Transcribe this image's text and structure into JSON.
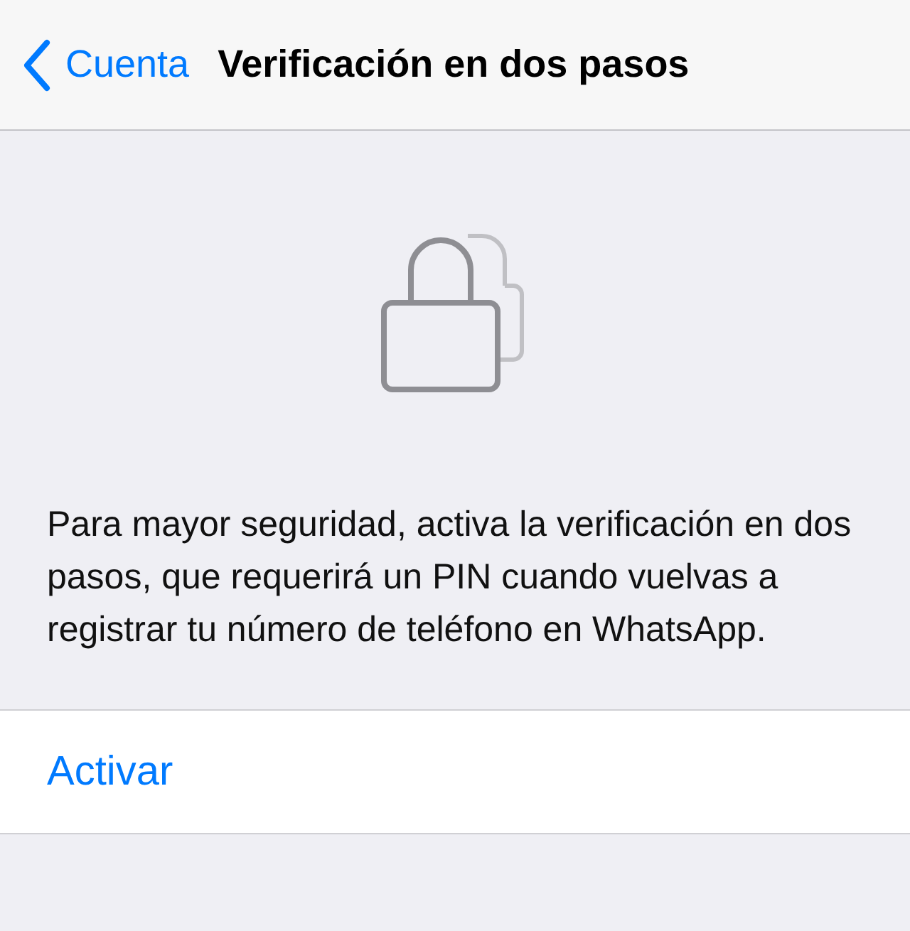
{
  "nav_bar": {
    "back_label": "Cuenta",
    "title": "Verificación en dos pasos"
  },
  "description": "Para mayor seguridad, activa la verificación en dos pasos, que requerirá un PIN cuando vuelvas a registrar tu número de teléfono en WhatsApp.",
  "actions": [
    {
      "label": "Activar"
    }
  ]
}
